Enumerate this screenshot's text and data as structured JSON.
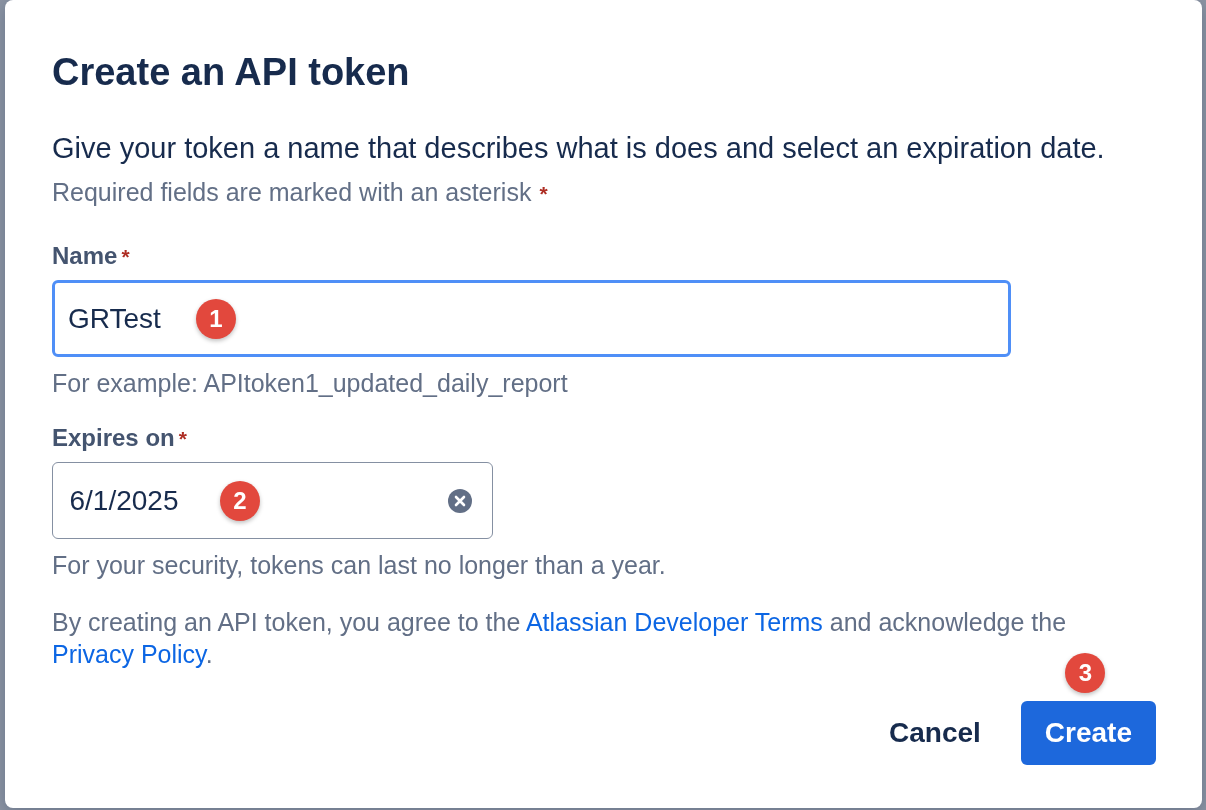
{
  "dialog": {
    "title": "Create an API token",
    "description": "Give your token a name that describes what is does and select an expiration date.",
    "required_note": {
      "text": "Required fields are marked with an asterisk",
      "asterisk": "*"
    },
    "fields": [
      {
        "kind": "text",
        "label": "Name",
        "required_mark": "*",
        "value": "GRTest",
        "focused": true,
        "marker": "1",
        "helper": "For example: APItoken1_updated_daily_report"
      },
      {
        "kind": "date",
        "label": "Expires on",
        "required_mark": "*",
        "value": "6/1/2025",
        "focused": false,
        "marker": "2",
        "clearable": true,
        "helper": "For your security, tokens can last no longer than a year."
      }
    ],
    "terms": [
      {
        "kind": "text",
        "text": "By creating an API token, you agree to the "
      },
      {
        "kind": "link",
        "text": "Atlassian Developer Terms"
      },
      {
        "kind": "text",
        "text": " and acknowledge the "
      },
      {
        "kind": "link",
        "text": "Privacy Policy"
      },
      {
        "kind": "text",
        "text": "."
      }
    ],
    "buttons": [
      {
        "kind": "subtle",
        "label": "Cancel"
      },
      {
        "kind": "primary",
        "label": "Create",
        "marker": "3"
      }
    ]
  }
}
